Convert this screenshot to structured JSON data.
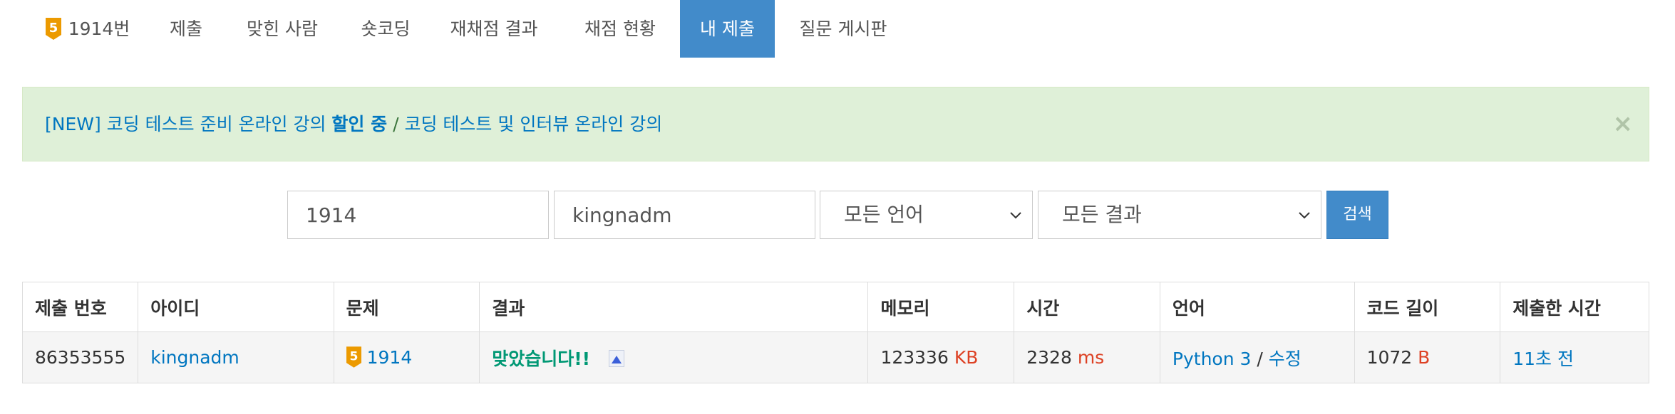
{
  "tabs": [
    {
      "label": "1914번",
      "tier": "5",
      "active": false
    },
    {
      "label": "제출",
      "active": false
    },
    {
      "label": "맞힌 사람",
      "active": false
    },
    {
      "label": "숏코딩",
      "active": false
    },
    {
      "label": "재채점 결과",
      "active": false
    },
    {
      "label": "채점 현황",
      "active": false
    },
    {
      "label": "내 제출",
      "active": true
    },
    {
      "label": "질문 게시판",
      "active": false
    }
  ],
  "alert": {
    "prefix": "[NEW] 코딩 테스트 준비 온라인 강의",
    "bold": "할인 중",
    "separator": "/",
    "link2": "코딩 테스트 및 인터뷰 온라인 강의",
    "close": "×"
  },
  "search": {
    "problem_value": "1914",
    "user_value": "kingnadm",
    "language_selected": "모든 언어",
    "result_selected": "모든 결과",
    "button": "검색"
  },
  "table": {
    "headers": [
      "제출 번호",
      "아이디",
      "문제",
      "결과",
      "메모리",
      "시간",
      "언어",
      "코드 길이",
      "제출한 시간"
    ],
    "rows": [
      {
        "submission_id": "86353555",
        "user": "kingnadm",
        "problem_tier": "5",
        "problem": "1914",
        "result": "맞았습니다!!",
        "memory": "123336",
        "memory_unit": "KB",
        "time": "2328",
        "time_unit": "ms",
        "language": "Python 3",
        "lang_sep": "/",
        "edit": "수정",
        "code_length": "1072",
        "code_unit": "B",
        "submitted": "11초 전"
      }
    ]
  },
  "colors": {
    "accent": "#428bca",
    "link": "#0076c0",
    "accepted": "#009874",
    "unit_red": "#dd4124",
    "tier_gold": "#ec9a00",
    "alert_bg": "#dff0d8"
  },
  "icons": {
    "tier": "gold-tier-badge-icon",
    "alert_close": "close-icon",
    "select_arrow": "chevron-down-icon",
    "result_share": "shared-code-icon"
  }
}
